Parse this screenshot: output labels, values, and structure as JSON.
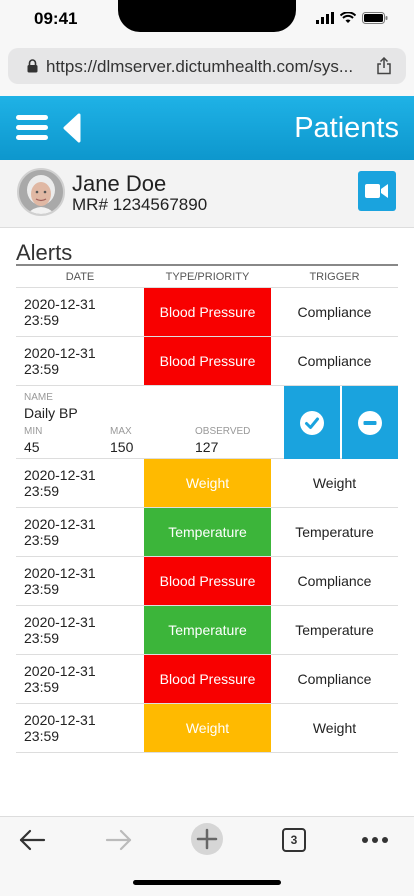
{
  "status": {
    "time": "09:41"
  },
  "browser": {
    "url": "https://dlmserver.dictumhealth.com/sys..."
  },
  "header": {
    "title": "Patients"
  },
  "patient": {
    "name": "Jane Doe",
    "mr": "MR# 1234567890"
  },
  "alerts": {
    "title": "Alerts",
    "columns": {
      "date": "DATE",
      "type": "TYPE/PRIORITY",
      "trigger": "TRIGGER"
    },
    "rows": [
      {
        "date": "2020-12-31",
        "time": "23:59",
        "type": "Blood Pressure",
        "color": "#f80000",
        "trigger": "Compliance"
      },
      {
        "date": "2020-12-31",
        "time": "23:59",
        "type": "Blood Pressure",
        "color": "#f80000",
        "trigger": "Compliance"
      },
      {
        "date": "2020-12-31",
        "time": "23:59",
        "type": "Weight",
        "color": "#ffba00",
        "trigger": "Weight"
      },
      {
        "date": "2020-12-31",
        "time": "23:59",
        "type": "Temperature",
        "color": "#3cb53a",
        "trigger": "Temperature"
      },
      {
        "date": "2020-12-31",
        "time": "23:59",
        "type": "Blood Pressure",
        "color": "#f80000",
        "trigger": "Compliance"
      },
      {
        "date": "2020-12-31",
        "time": "23:59",
        "type": "Temperature",
        "color": "#3cb53a",
        "trigger": "Temperature"
      },
      {
        "date": "2020-12-31",
        "time": "23:59",
        "type": "Blood Pressure",
        "color": "#f80000",
        "trigger": "Compliance"
      },
      {
        "date": "2020-12-31",
        "time": "23:59",
        "type": "Weight",
        "color": "#ffba00",
        "trigger": "Weight"
      }
    ],
    "detail": {
      "name_label": "NAME",
      "name": "Daily BP",
      "min_label": "MIN",
      "min": "45",
      "max_label": "MAX",
      "max": "150",
      "observed_label": "OBSERVED",
      "observed": "127"
    }
  },
  "toolbar": {
    "tab_count": "3"
  },
  "colors": {
    "accent": "#1aa3de",
    "red": "#f80000",
    "orange": "#ffba00",
    "green": "#3cb53a"
  },
  "icons": [
    "hamburger-menu-icon",
    "back-arrow-icon",
    "video-camera-icon",
    "check-circle-icon",
    "minus-circle-icon",
    "lock-icon",
    "share-icon"
  ]
}
